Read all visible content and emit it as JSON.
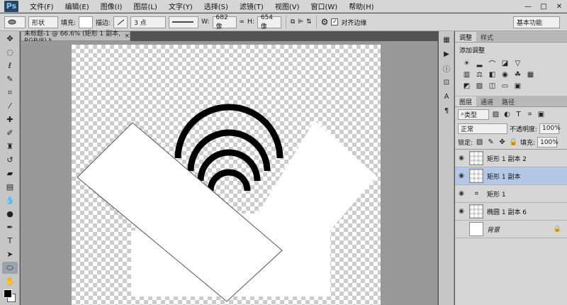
{
  "menubar": {
    "logo": "Ps",
    "items": [
      "文件(F)",
      "编辑(E)",
      "图像(I)",
      "图层(L)",
      "文字(Y)",
      "选择(S)",
      "滤镜(T)",
      "视图(V)",
      "窗口(W)",
      "帮助(H)"
    ],
    "window_controls": [
      "—",
      "□",
      "✕"
    ]
  },
  "options": {
    "mode": "形状",
    "fill_label": "填充:",
    "stroke_label": "描边:",
    "stroke_width": "3 点",
    "w_label": "W:",
    "w_value": "682 像",
    "h_label": "H:",
    "h_value": "654 像",
    "align_edges": "对齐边缘",
    "align_checked": true,
    "workspace": "基本功能"
  },
  "document": {
    "tab_title": "未标题-1 @ 66.6% (矩形 1 副本, RGB/8) *",
    "tab_close": "×"
  },
  "panels": {
    "top_tabs": [
      "调整",
      "样式"
    ],
    "adjust_title": "添加调整",
    "layer_tabs": [
      "图层",
      "通道",
      "路径"
    ],
    "filter_kind": "类型",
    "blend_mode": "正常",
    "opacity_label": "不透明度:",
    "opacity_value": "100%",
    "lock_label": "锁定:",
    "fill_label": "填充:",
    "fill_value": "100%"
  },
  "layers": [
    {
      "name": "矩形 1 副本 2",
      "visible": true,
      "selected": false
    },
    {
      "name": "矩形 1 副本",
      "visible": true,
      "selected": true
    },
    {
      "name": "矩形 1",
      "visible": true,
      "selected": false
    },
    {
      "name": "椭圆 1 副本 6",
      "visible": true,
      "selected": false
    },
    {
      "name": "背景",
      "visible": false,
      "selected": false
    }
  ],
  "colors": {
    "foreground": "#000000",
    "background": "#ffffff",
    "selection": "#b3c8e6"
  }
}
